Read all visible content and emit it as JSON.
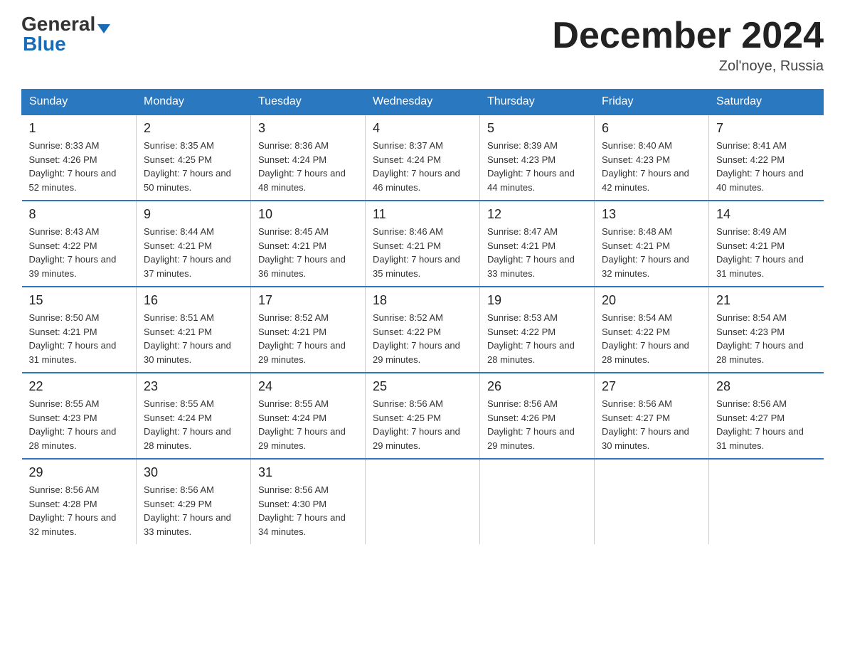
{
  "logo": {
    "general": "General",
    "blue": "Blue",
    "triangle": "▲"
  },
  "title": "December 2024",
  "location": "Zol'noye, Russia",
  "weekdays": [
    "Sunday",
    "Monday",
    "Tuesday",
    "Wednesday",
    "Thursday",
    "Friday",
    "Saturday"
  ],
  "weeks": [
    [
      {
        "day": "1",
        "sunrise": "8:33 AM",
        "sunset": "4:26 PM",
        "daylight": "7 hours and 52 minutes."
      },
      {
        "day": "2",
        "sunrise": "8:35 AM",
        "sunset": "4:25 PM",
        "daylight": "7 hours and 50 minutes."
      },
      {
        "day": "3",
        "sunrise": "8:36 AM",
        "sunset": "4:24 PM",
        "daylight": "7 hours and 48 minutes."
      },
      {
        "day": "4",
        "sunrise": "8:37 AM",
        "sunset": "4:24 PM",
        "daylight": "7 hours and 46 minutes."
      },
      {
        "day": "5",
        "sunrise": "8:39 AM",
        "sunset": "4:23 PM",
        "daylight": "7 hours and 44 minutes."
      },
      {
        "day": "6",
        "sunrise": "8:40 AM",
        "sunset": "4:23 PM",
        "daylight": "7 hours and 42 minutes."
      },
      {
        "day": "7",
        "sunrise": "8:41 AM",
        "sunset": "4:22 PM",
        "daylight": "7 hours and 40 minutes."
      }
    ],
    [
      {
        "day": "8",
        "sunrise": "8:43 AM",
        "sunset": "4:22 PM",
        "daylight": "7 hours and 39 minutes."
      },
      {
        "day": "9",
        "sunrise": "8:44 AM",
        "sunset": "4:21 PM",
        "daylight": "7 hours and 37 minutes."
      },
      {
        "day": "10",
        "sunrise": "8:45 AM",
        "sunset": "4:21 PM",
        "daylight": "7 hours and 36 minutes."
      },
      {
        "day": "11",
        "sunrise": "8:46 AM",
        "sunset": "4:21 PM",
        "daylight": "7 hours and 35 minutes."
      },
      {
        "day": "12",
        "sunrise": "8:47 AM",
        "sunset": "4:21 PM",
        "daylight": "7 hours and 33 minutes."
      },
      {
        "day": "13",
        "sunrise": "8:48 AM",
        "sunset": "4:21 PM",
        "daylight": "7 hours and 32 minutes."
      },
      {
        "day": "14",
        "sunrise": "8:49 AM",
        "sunset": "4:21 PM",
        "daylight": "7 hours and 31 minutes."
      }
    ],
    [
      {
        "day": "15",
        "sunrise": "8:50 AM",
        "sunset": "4:21 PM",
        "daylight": "7 hours and 31 minutes."
      },
      {
        "day": "16",
        "sunrise": "8:51 AM",
        "sunset": "4:21 PM",
        "daylight": "7 hours and 30 minutes."
      },
      {
        "day": "17",
        "sunrise": "8:52 AM",
        "sunset": "4:21 PM",
        "daylight": "7 hours and 29 minutes."
      },
      {
        "day": "18",
        "sunrise": "8:52 AM",
        "sunset": "4:22 PM",
        "daylight": "7 hours and 29 minutes."
      },
      {
        "day": "19",
        "sunrise": "8:53 AM",
        "sunset": "4:22 PM",
        "daylight": "7 hours and 28 minutes."
      },
      {
        "day": "20",
        "sunrise": "8:54 AM",
        "sunset": "4:22 PM",
        "daylight": "7 hours and 28 minutes."
      },
      {
        "day": "21",
        "sunrise": "8:54 AM",
        "sunset": "4:23 PM",
        "daylight": "7 hours and 28 minutes."
      }
    ],
    [
      {
        "day": "22",
        "sunrise": "8:55 AM",
        "sunset": "4:23 PM",
        "daylight": "7 hours and 28 minutes."
      },
      {
        "day": "23",
        "sunrise": "8:55 AM",
        "sunset": "4:24 PM",
        "daylight": "7 hours and 28 minutes."
      },
      {
        "day": "24",
        "sunrise": "8:55 AM",
        "sunset": "4:24 PM",
        "daylight": "7 hours and 29 minutes."
      },
      {
        "day": "25",
        "sunrise": "8:56 AM",
        "sunset": "4:25 PM",
        "daylight": "7 hours and 29 minutes."
      },
      {
        "day": "26",
        "sunrise": "8:56 AM",
        "sunset": "4:26 PM",
        "daylight": "7 hours and 29 minutes."
      },
      {
        "day": "27",
        "sunrise": "8:56 AM",
        "sunset": "4:27 PM",
        "daylight": "7 hours and 30 minutes."
      },
      {
        "day": "28",
        "sunrise": "8:56 AM",
        "sunset": "4:27 PM",
        "daylight": "7 hours and 31 minutes."
      }
    ],
    [
      {
        "day": "29",
        "sunrise": "8:56 AM",
        "sunset": "4:28 PM",
        "daylight": "7 hours and 32 minutes."
      },
      {
        "day": "30",
        "sunrise": "8:56 AM",
        "sunset": "4:29 PM",
        "daylight": "7 hours and 33 minutes."
      },
      {
        "day": "31",
        "sunrise": "8:56 AM",
        "sunset": "4:30 PM",
        "daylight": "7 hours and 34 minutes."
      },
      null,
      null,
      null,
      null
    ]
  ]
}
